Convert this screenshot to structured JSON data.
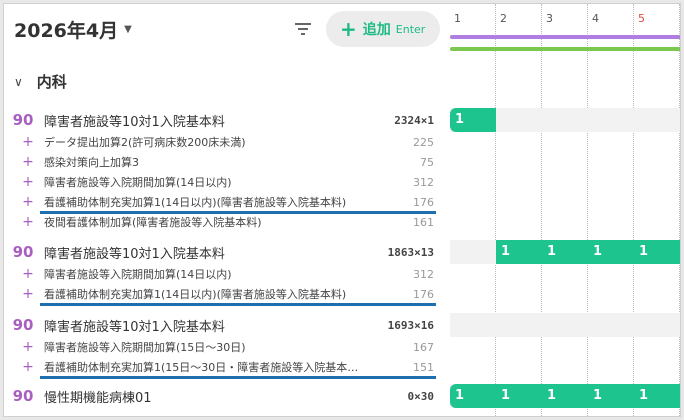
{
  "header": {
    "month": "2026年4月",
    "add_label": "追加",
    "add_key": "Enter"
  },
  "section": {
    "title": "内科"
  },
  "colors": {
    "accent": "#1ec48d",
    "code": "#a85fc0",
    "purple_lane": "#b07ee0",
    "green_lane": "#7ac94e",
    "underline": "#1e6fb0",
    "saturday": "#e0483c"
  },
  "groups": [
    {
      "code": "90",
      "name": "障害者施設等10対1入院基本料",
      "value": "2324×1",
      "days": [
        "1",
        "",
        "",
        "",
        ""
      ],
      "subs": [
        {
          "name": "データ提出加算2(許可病床数200床未満)",
          "value": "225"
        },
        {
          "name": "感染対策向上加算3",
          "value": "75"
        },
        {
          "name": "障害者施設等入院期間加算(14日以内)",
          "value": "312"
        },
        {
          "name": "看護補助体制充実加算1(14日以内)(障害者施設等入院基本料)",
          "value": "176"
        },
        {
          "name": "夜間看護体制加算(障害者施設等入院基本料)",
          "value": "161"
        }
      ]
    },
    {
      "code": "90",
      "name": "障害者施設等10対1入院基本料",
      "value": "1863×13",
      "days": [
        "",
        "1",
        "1",
        "1",
        "1"
      ],
      "subs": [
        {
          "name": "障害者施設等入院期間加算(14日以内)",
          "value": "312"
        },
        {
          "name": "看護補助体制充実加算1(14日以内)(障害者施設等入院基本料)",
          "value": "176"
        }
      ]
    },
    {
      "code": "90",
      "name": "障害者施設等10対1入院基本料",
      "value": "1693×16",
      "days": [
        "",
        "",
        "",
        "",
        ""
      ],
      "subs": [
        {
          "name": "障害者施設等入院期間加算(15日〜30日)",
          "value": "167"
        },
        {
          "name": "看護補助体制充実加算1(15日〜30日・障害者施設等入院基本…",
          "value": "151"
        }
      ]
    },
    {
      "code": "90",
      "name": "慢性期機能病棟01",
      "value": "0×30",
      "days": [
        "1",
        "1",
        "1",
        "1",
        "1"
      ],
      "subs": []
    }
  ],
  "calendar": {
    "days": [
      "1",
      "2",
      "3",
      "4",
      "5"
    ],
    "saturday_index": 4
  }
}
